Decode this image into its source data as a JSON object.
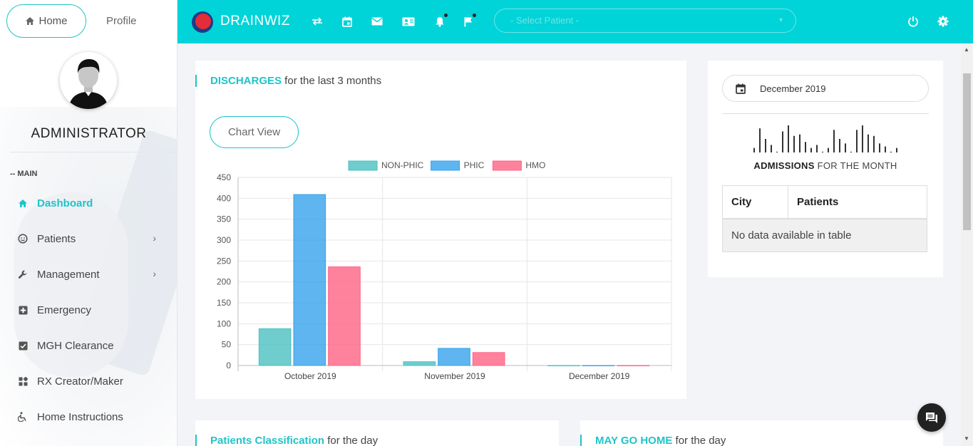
{
  "sidebar": {
    "tabs": {
      "home": "Home",
      "profile": "Profile"
    },
    "role": "ADMINISTRATOR",
    "section_label": "-- MAIN",
    "items": [
      {
        "label": "Dashboard",
        "icon": "home-icon",
        "active": true
      },
      {
        "label": "Patients",
        "icon": "smile-icon",
        "submenu": true
      },
      {
        "label": "Management",
        "icon": "wrench-icon",
        "submenu": true
      },
      {
        "label": "Emergency",
        "icon": "plus-box-icon"
      },
      {
        "label": "MGH Clearance",
        "icon": "checkbox-icon"
      },
      {
        "label": "RX Creator/Maker",
        "icon": "widgets-icon"
      },
      {
        "label": "Home Instructions",
        "icon": "wheelchair-icon"
      }
    ]
  },
  "topbar": {
    "brand": "DRAINWIZ",
    "select_patient": "- Select Patient -",
    "icons": [
      "swap-icon",
      "calendar-icon",
      "mail-icon",
      "contact-card-icon",
      "bell-icon",
      "flag-icon",
      "power-icon",
      "gear-icon"
    ]
  },
  "discharges": {
    "title_bold": "DISCHARGES",
    "title_rest": " for the last 3 months",
    "chart_view_label": "Chart View"
  },
  "chart_data": {
    "type": "bar",
    "categories": [
      "October 2019",
      "November 2019",
      "December 2019"
    ],
    "series": [
      {
        "name": "NON-PHIC",
        "values": [
          88,
          9,
          0
        ],
        "color": "#4bc0c0"
      },
      {
        "name": "PHIC",
        "values": [
          409,
          41,
          0
        ],
        "color": "#36a2eb"
      },
      {
        "name": "HMO",
        "values": [
          236,
          31,
          0
        ],
        "color": "#ff6384"
      }
    ],
    "yticks": [
      450,
      400,
      350,
      300,
      250,
      200,
      150,
      100,
      50,
      0
    ],
    "ylim": [
      0,
      450
    ],
    "legend": "top",
    "grid": true
  },
  "admissions": {
    "date_value": "December  2019",
    "title_bold": "ADMISSIONS",
    "title_rest": " FOR THE MONTH",
    "sparkline": [
      6,
      32,
      18,
      10,
      1,
      28,
      36,
      22,
      24,
      14,
      6,
      10,
      1,
      6,
      30,
      18,
      12,
      1,
      30,
      36,
      24,
      22,
      12,
      8,
      1,
      6
    ],
    "table": {
      "headers": [
        "City",
        "Patients"
      ],
      "empty_text": "No data available in table"
    }
  },
  "bottom": {
    "classification_bold": "Patients Classification",
    "classification_rest": " for the day",
    "maygohome_bold": "MAY GO HOME",
    "maygohome_rest": " for the day"
  }
}
